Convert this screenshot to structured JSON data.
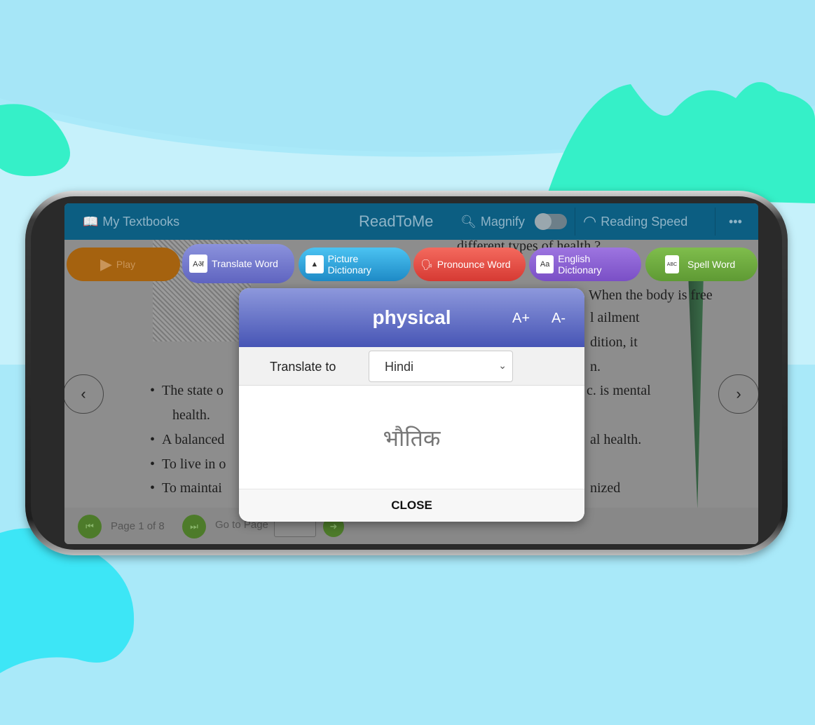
{
  "header": {
    "my_textbooks": "My Textbooks",
    "title": "ReadToMe",
    "magnify": "Magnify",
    "reading_speed": "Reading Speed",
    "more": "•••"
  },
  "toolbar": [
    {
      "label": "Play",
      "color": "#b06a10",
      "icon": "play-icon"
    },
    {
      "label": "Translate Word",
      "color": "#6f74cc",
      "icon": "translate-icon",
      "glyph": "Aअ"
    },
    {
      "label": "Picture Dictionary",
      "color": "#2a9fd4",
      "icon": "picture-icon",
      "glyph": "▲"
    },
    {
      "label": "Pronounce Word",
      "color": "#e14a40",
      "icon": "speaker-head-icon",
      "glyph": "🗣"
    },
    {
      "label": "English Dictionary",
      "color": "#8a5ed0",
      "icon": "dictionary-icon",
      "glyph": "Aa"
    },
    {
      "label": "Spell Word",
      "color": "#6ba63e",
      "icon": "spell-icon",
      "glyph": "ABC"
    }
  ],
  "book": {
    "lines": [
      "different types of health ?",
      "When the body is free",
      "l ailment",
      "dition, it",
      "n.",
      "The state o",
      "c. is mental",
      "health.",
      "A balanced",
      "al health.",
      "To live in o",
      "To maintai",
      "nized"
    ]
  },
  "footer": {
    "page_label": "Page 1 of 8",
    "goto_label": "Go to Page",
    "goto_value": ""
  },
  "modal": {
    "word": "physical",
    "font_increase": "A+",
    "font_decrease": "A-",
    "translate_to_label": "Translate to",
    "language": "Hindi",
    "translation": "भौतिक",
    "close": "CLOSE"
  }
}
